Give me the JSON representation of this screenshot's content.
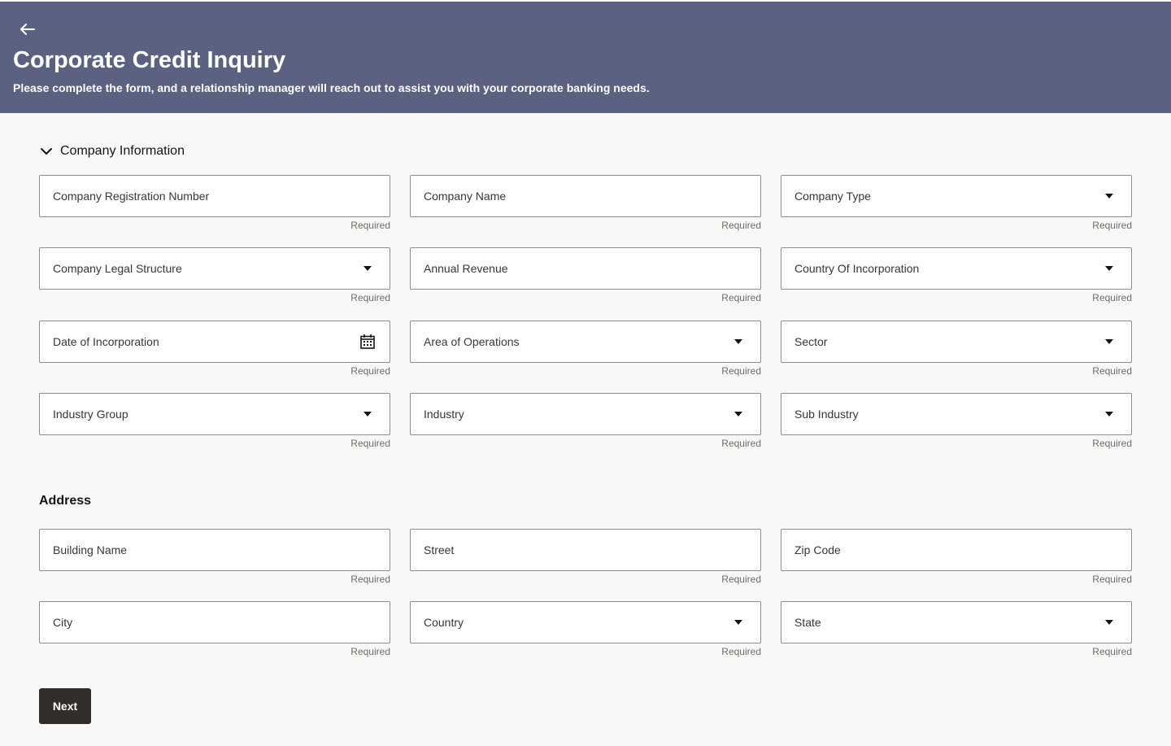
{
  "header": {
    "title": "Corporate Credit Inquiry",
    "subtitle": "Please complete the form, and a relationship manager will reach out to assist you with your corporate banking needs."
  },
  "company_section": {
    "title": "Company Information",
    "fields": [
      {
        "label": "Company Registration Number",
        "type": "text",
        "help": "Required"
      },
      {
        "label": "Company Name",
        "type": "text",
        "help": "Required"
      },
      {
        "label": "Company Type",
        "type": "select",
        "help": "Required"
      },
      {
        "label": "Company Legal Structure",
        "type": "select",
        "help": "Required"
      },
      {
        "label": "Annual Revenue",
        "type": "text",
        "help": "Required"
      },
      {
        "label": "Country Of Incorporation",
        "type": "select",
        "help": "Required"
      },
      {
        "label": "Date of Incorporation",
        "type": "date",
        "help": "Required"
      },
      {
        "label": "Area of Operations",
        "type": "select",
        "help": "Required"
      },
      {
        "label": "Sector",
        "type": "select",
        "help": "Required"
      },
      {
        "label": "Industry Group",
        "type": "select",
        "help": "Required"
      },
      {
        "label": "Industry",
        "type": "select",
        "help": "Required"
      },
      {
        "label": "Sub Industry",
        "type": "select",
        "help": "Required"
      }
    ]
  },
  "address_section": {
    "title": "Address",
    "fields": [
      {
        "label": "Building Name",
        "type": "text",
        "help": "Required"
      },
      {
        "label": "Street",
        "type": "text",
        "help": "Required"
      },
      {
        "label": "Zip Code",
        "type": "text",
        "help": "Required"
      },
      {
        "label": "City",
        "type": "text",
        "help": "Required"
      },
      {
        "label": "Country",
        "type": "select",
        "help": "Required"
      },
      {
        "label": "State",
        "type": "select",
        "help": "Required"
      }
    ]
  },
  "actions": {
    "next_label": "Next"
  },
  "colors": {
    "header_bg": "#5b6180",
    "page_bg": "#f9f8f6",
    "button_bg": "#312d2a"
  }
}
